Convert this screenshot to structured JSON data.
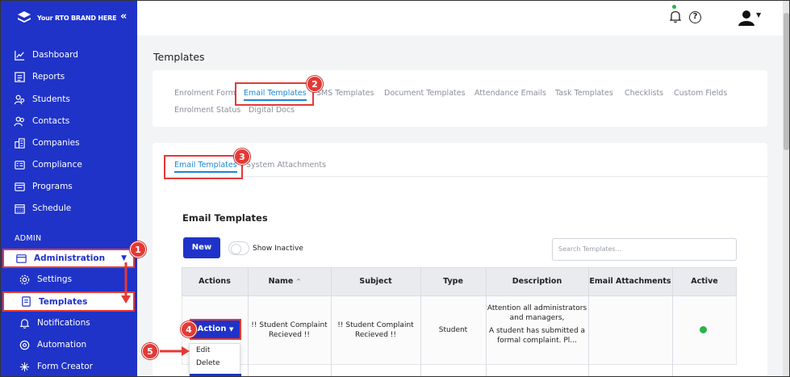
{
  "brand": {
    "name": "Your RTO BRAND HERE",
    "collapse_icon": "«"
  },
  "sidebar": {
    "items": [
      {
        "label": "Dashboard",
        "icon": "chart-line-icon"
      },
      {
        "label": "Reports",
        "icon": "report-icon"
      },
      {
        "label": "Students",
        "icon": "students-icon"
      },
      {
        "label": "Contacts",
        "icon": "contacts-icon"
      },
      {
        "label": "Companies",
        "icon": "building-icon"
      },
      {
        "label": "Compliance",
        "icon": "compliance-icon"
      },
      {
        "label": "Programs",
        "icon": "programs-icon"
      },
      {
        "label": "Schedule",
        "icon": "calendar-icon"
      }
    ],
    "section": "ADMIN",
    "admin_items": [
      {
        "label": "Administration"
      },
      {
        "label": "Settings"
      },
      {
        "label": "Templates"
      },
      {
        "label": "Notifications"
      },
      {
        "label": "Automation"
      },
      {
        "label": "Form Creator"
      }
    ]
  },
  "page": {
    "title": "Templates"
  },
  "template_tabs": {
    "row1": [
      "Enrolment Form",
      "Email Templates",
      "SMS Templates",
      "Document Templates",
      "Attendance Emails",
      "Task Templates",
      "Checklists",
      "Custom Fields"
    ],
    "row2": [
      "Enrolment Status",
      "Digital Docs"
    ],
    "selected": "Email Templates"
  },
  "sub_tabs": {
    "items": [
      "Email Templates",
      "System Attachments"
    ],
    "selected": "Email Templates"
  },
  "section": {
    "title": "Email Templates"
  },
  "toolbar": {
    "new_label": "New",
    "show_inactive_label": "Show Inactive",
    "search_placeholder": "Search Templates..."
  },
  "table": {
    "columns": [
      "Actions",
      "Name",
      "Subject",
      "Type",
      "Description",
      "Email Attachments",
      "Active"
    ],
    "sort_indicator": "^",
    "row": {
      "name_line1": "!! Student Complaint",
      "name_line2": "Recieved !!",
      "subject_line1": "!! Student Complaint",
      "subject_line2": "Recieved !!",
      "type": "Student",
      "desc_line1": "Attention all administrators",
      "desc_line2": "and managers,",
      "desc_line3": "A student has submitted a",
      "desc_line4": "formal complaint. Pl...",
      "active": true
    },
    "action_label": "Action",
    "action_menu": [
      "Edit",
      "Delete"
    ]
  },
  "callouts": [
    "1",
    "2",
    "3",
    "4",
    "5"
  ],
  "colors": {
    "sidebar": "#1f33c8",
    "accent": "#1a86d8",
    "callout": "#e53935",
    "active_dot": "#28b34b"
  }
}
